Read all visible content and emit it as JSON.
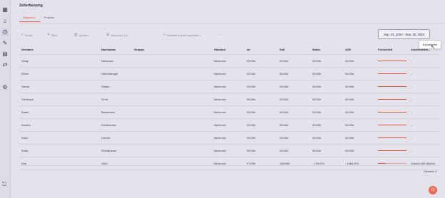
{
  "page_title": "Zeiterfassung",
  "tabs": [
    {
      "label": "Allgemein",
      "active": true
    },
    {
      "label": "Projekte",
      "active": false
    }
  ],
  "toolbar": {
    "search_placeholder": "Suche",
    "filter_label": "Filter",
    "columns_label": "Spalten",
    "view_label": "Ansichten (1)",
    "save_view_label": "Aktuelle Ansicht speichern",
    "more_label": "···",
    "date_range": "Sep. 01, 2024 - Sep. 30, 2024",
    "export_label": "Exportieren"
  },
  "table": {
    "headers": {
      "vorname": "Vorname",
      "nachname": "Nachname",
      "gruppe": "Gruppe",
      "standort": "Standort",
      "ist": "Ist",
      "soll": "Soll",
      "saldo": "Saldo",
      "azk": "AZK",
      "fortschritt": "Fortschritt",
      "arbeitszeitmodell": "Arbeitszeitm..."
    },
    "rows": [
      {
        "vorname": "Vinay",
        "nachname": "Nextronix",
        "gruppe": "",
        "standort": "Nextronix",
        "ist": "00:00h",
        "soll": "00:00h",
        "saldo": "00:00h",
        "azk": "00:00h",
        "fortschritt": 1.0,
        "arbeitszeitmodell": "-"
      },
      {
        "vorname": "Elmer",
        "nachname": "Hohenberger",
        "gruppe": "",
        "standort": "Nextronix",
        "ist": "00:00h",
        "soll": "00:00h",
        "saldo": "00:00h",
        "azk": "00:00h",
        "fortschritt": 1.0,
        "arbeitszeitmodell": "-"
      },
      {
        "vorname": "Stever",
        "nachname": "Özkan",
        "gruppe": "",
        "standort": "Nextronix",
        "ist": "00:00h",
        "soll": "00:00h",
        "saldo": "00:00h",
        "azk": "00:00h",
        "fortschritt": 1.0,
        "arbeitszeitmodell": "-"
      },
      {
        "vorname": "Christoph",
        "nachname": "Groß",
        "gruppe": "",
        "standort": "Nextronix",
        "ist": "00:00h",
        "soll": "00:00h",
        "saldo": "00:00h",
        "azk": "00:00h",
        "fortschritt": 1.0,
        "arbeitszeitmodell": "-"
      },
      {
        "vorname": "Adam",
        "nachname": "Bachmann",
        "gruppe": "",
        "standort": "Nextronix",
        "ist": "00:00h",
        "soll": "00:00h",
        "saldo": "00:00h",
        "azk": "00:00h",
        "fortschritt": 1.0,
        "arbeitszeitmodell": "-"
      },
      {
        "vorname": "Sandro",
        "nachname": "Fankhauser",
        "gruppe": "",
        "standort": "Nextronix",
        "ist": "00:00h",
        "soll": "00:00h",
        "saldo": "00:00h",
        "azk": "00:00h",
        "fortschritt": 1.0,
        "arbeitszeitmodell": "-"
      },
      {
        "vorname": "Karin",
        "nachname": "Lienert",
        "gruppe": "",
        "standort": "Nextronix",
        "ist": "00:00h",
        "soll": "00:00h",
        "saldo": "00:00h",
        "azk": "00:00h",
        "fortschritt": 1.0,
        "arbeitszeitmodell": "-"
      },
      {
        "vorname": "Anita",
        "nachname": "Zenhäusern",
        "gruppe": "",
        "standort": "Nextronix",
        "ist": "00:00h",
        "soll": "00:00h",
        "saldo": "00:00h",
        "azk": "00:00h",
        "fortschritt": 1.0,
        "arbeitszeitmodell": "-"
      },
      {
        "vorname": "Doe",
        "nachname": "John",
        "gruppe": "",
        "standort": "Nextronix",
        "ist": "47:03h",
        "soll": "168:00h",
        "saldo": "- 120:57h",
        "azk": "- 1464:57h",
        "fortschritt": 0.28,
        "arbeitszeitmodell": "Vollzeit 40h Woche"
      }
    ],
    "total_label": "Gesamt: 9"
  },
  "colors": {
    "accent": "#e15a46",
    "background": "#e4e3ec"
  }
}
